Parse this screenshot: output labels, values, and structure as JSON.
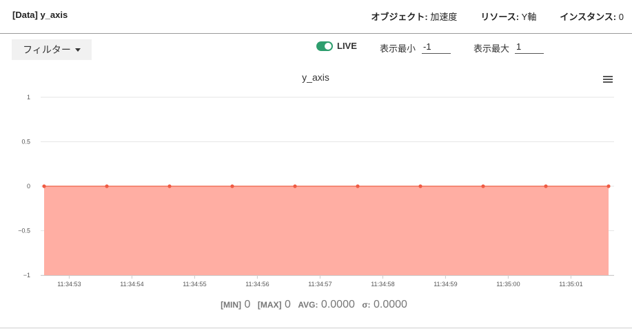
{
  "header": {
    "title": "[Data] y_axis",
    "object_label": "オブジェクト:",
    "object_value": "加速度",
    "resource_label": "リソース:",
    "resource_value": "Y軸",
    "instance_label": "インスタンス:",
    "instance_value": "0"
  },
  "toolbar": {
    "filter_label": "フィルター",
    "live_label": "LIVE",
    "live_on": true,
    "min_label": "表示最小",
    "min_value": "-1",
    "max_label": "表示最大",
    "max_value": "1"
  },
  "colors": {
    "area_fill": "#ffaea3",
    "series_line": "#f0705a",
    "point": "#ef5b43",
    "toggle_on": "#2e9e6e"
  },
  "icons": {
    "menu": "hamburger-menu-icon",
    "filter_caret": "caret-down-icon"
  },
  "chart_data": {
    "type": "area",
    "title": "y_axis",
    "xlabel": "",
    "ylabel": "",
    "ylim": [
      -1,
      1
    ],
    "y_ticks": [
      "1",
      "0.5",
      "0",
      "−0.5",
      "−1"
    ],
    "y_tick_values": [
      1,
      0.5,
      0,
      -0.5,
      -1
    ],
    "x_ticks": [
      "11:34:53",
      "11:34:54",
      "11:34:55",
      "11:34:56",
      "11:34:57",
      "11:34:58",
      "11:34:59",
      "11:35:00",
      "11:35:01"
    ],
    "xlim": [
      "11:34:52.6",
      "11:35:01.6"
    ],
    "x": [
      "11:34:52.6",
      "11:34:53.6",
      "11:34:54.6",
      "11:34:55.6",
      "11:34:56.6",
      "11:34:57.6",
      "11:34:58.6",
      "11:34:59.6",
      "11:35:00.6",
      "11:35:01.6"
    ],
    "series": [
      {
        "values": [
          0,
          0,
          0,
          0,
          0,
          0,
          0,
          0,
          0,
          0
        ]
      }
    ],
    "grid": true,
    "legend": "none"
  },
  "stats": {
    "min_label": "[MIN]",
    "min_value": "0",
    "max_label": "[MAX]",
    "max_value": "0",
    "avg_label": "AVG:",
    "avg_value": "0.0000",
    "sigma_label": "σ:",
    "sigma_value": "0.0000"
  }
}
